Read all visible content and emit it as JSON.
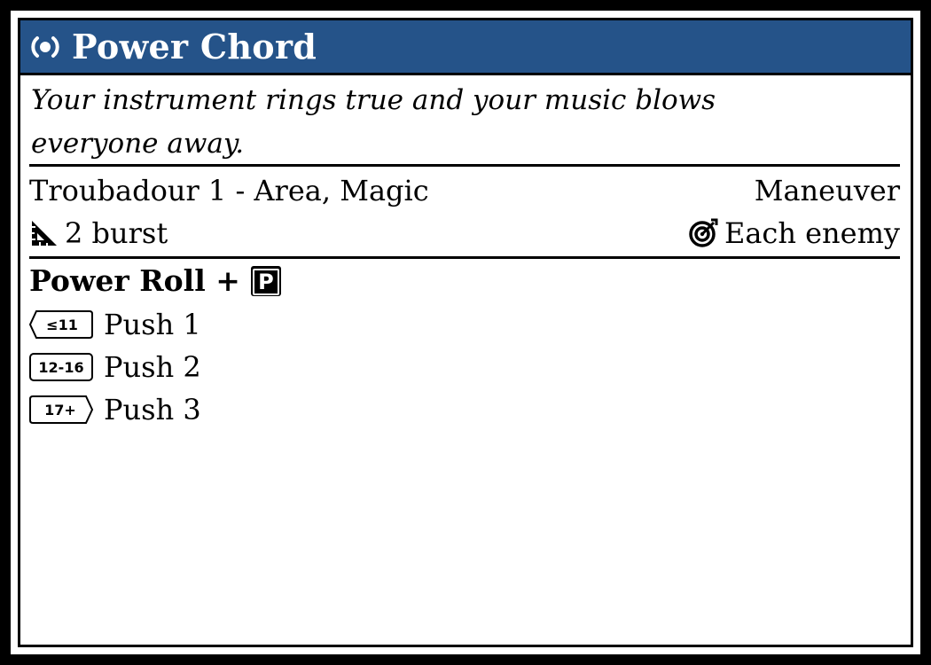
{
  "card": {
    "title": "Power Chord",
    "title_icon": "radio-broadcast-icon",
    "flavor": "Your instrument rings true and your music blows everyone away.",
    "keywords": "Troubadour 1 - Area, Magic",
    "action_type": "Maneuver",
    "distance_icon": "triangle-ruler-icon",
    "distance": "2 burst",
    "target_icon": "target-icon",
    "target": "Each enemy",
    "power_roll_label": "Power Roll +",
    "power_roll_stat": "P",
    "tiers": [
      {
        "range": "≤11",
        "effect": "Push 1"
      },
      {
        "range": "12-16",
        "effect": "Push 2"
      },
      {
        "range": "17+",
        "effect": "Push 3"
      }
    ]
  },
  "colors": {
    "header": "#255389",
    "frame": "#000000",
    "background": "#ffffff"
  }
}
